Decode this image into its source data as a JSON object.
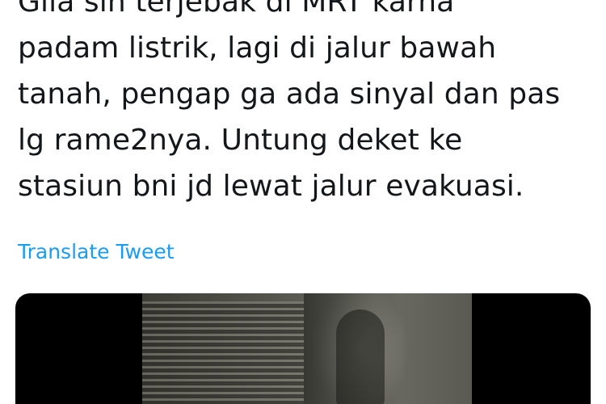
{
  "tweet": {
    "text_lines": [
      "Gila sih terjebak di MRT karna",
      "padam listrik, lagi di jalur bawah",
      "tanah, pengap ga ada sinyal dan pas",
      "lg rame2nya. Untung deket ke",
      "stasiun bni jd lewat jalur evakuasi."
    ],
    "translate_label": "Translate Tweet"
  },
  "colors": {
    "text": "#14171a",
    "link": "#1d9bf0",
    "media_background": "#000000"
  }
}
